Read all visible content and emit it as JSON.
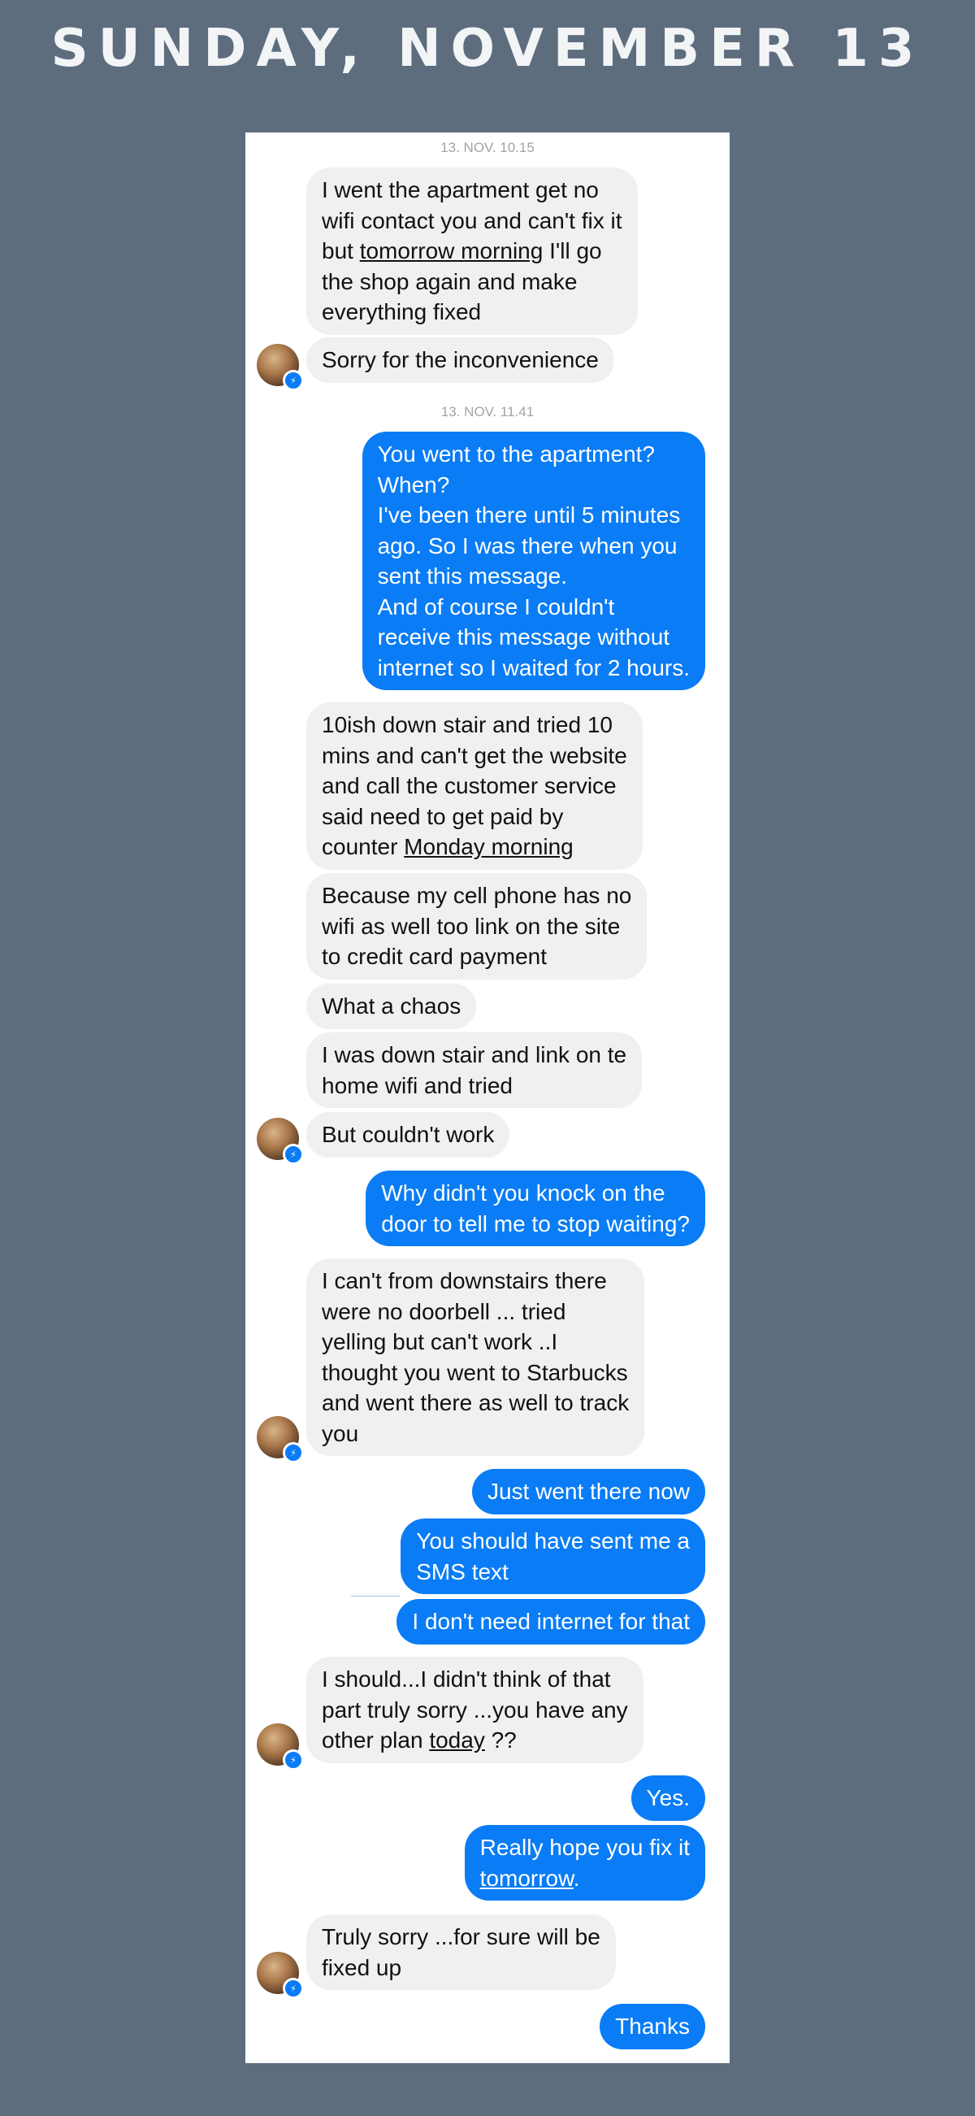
{
  "header": {
    "title": "SUNDAY, NOVEMBER 13"
  },
  "timestamps": [
    "13. NOV. 10.15",
    "13. NOV. 11.41"
  ],
  "messages": [
    {
      "from": "them",
      "parts": [
        [
          "I went the apartment get no\nwifi contact you and can't fix it\nbut ",
          false
        ],
        [
          "tomorrow morning",
          true
        ],
        [
          " I'll go\nthe shop again and make\neverything fixed",
          false
        ]
      ]
    },
    {
      "from": "them",
      "parts": [
        [
          "Sorry for the inconvenience",
          false
        ]
      ]
    },
    {
      "from": "me",
      "parts": [
        [
          "You went to the apartment?\nWhen?\nI've been there until 5 minutes\nago. So I was there when you\nsent this message.\nAnd of course I couldn't\nreceive this message without\ninternet so I waited for 2 hours.",
          false
        ]
      ]
    },
    {
      "from": "them",
      "parts": [
        [
          "10ish down stair and tried 10\nmins and can't get the website\nand call the customer service\nsaid need to get paid by\ncounter ",
          false
        ],
        [
          "Monday morning",
          true
        ]
      ]
    },
    {
      "from": "them",
      "parts": [
        [
          "Because my cell phone has no\nwifi as well too link on the site\nto credit card payment",
          false
        ]
      ]
    },
    {
      "from": "them",
      "parts": [
        [
          "What a chaos",
          false
        ]
      ]
    },
    {
      "from": "them",
      "parts": [
        [
          "I was down stair and link on te\nhome wifi and tried",
          false
        ]
      ]
    },
    {
      "from": "them",
      "parts": [
        [
          "But couldn't work",
          false
        ]
      ]
    },
    {
      "from": "me",
      "parts": [
        [
          "Why didn't you knock on the\ndoor to tell me to stop waiting?",
          false
        ]
      ]
    },
    {
      "from": "them",
      "parts": [
        [
          "I can't from downstairs there\nwere no doorbell ... tried\nyelling but can't work ..I\nthought you went to Starbucks\nand went there as well to track\nyou",
          false
        ]
      ]
    },
    {
      "from": "me",
      "parts": [
        [
          "Just went there now",
          false
        ]
      ]
    },
    {
      "from": "me",
      "parts": [
        [
          "You should have sent me a\nSMS text",
          false
        ]
      ]
    },
    {
      "from": "me",
      "parts": [
        [
          "I don't need internet for that",
          false
        ]
      ]
    },
    {
      "from": "them",
      "parts": [
        [
          "I should...I didn't think of that\npart truly sorry ...you have any\nother plan ",
          false
        ],
        [
          "today",
          true
        ],
        [
          " ??",
          false
        ]
      ]
    },
    {
      "from": "me",
      "parts": [
        [
          "Yes.",
          false
        ]
      ]
    },
    {
      "from": "me",
      "parts": [
        [
          "Really hope you fix it\n",
          false
        ],
        [
          "tomorrow",
          true
        ],
        [
          ".",
          false
        ]
      ]
    },
    {
      "from": "them",
      "parts": [
        [
          "Truly sorry ...for sure will be\nfixed up",
          false
        ]
      ]
    },
    {
      "from": "me",
      "parts": [
        [
          "Thanks",
          false
        ]
      ]
    }
  ],
  "colors": {
    "background": "#5d6d7e",
    "incoming_bubble": "#f0eff1",
    "outgoing_bubble": "#0a7cf5"
  },
  "icons": {
    "avatar": "contact-avatar",
    "badge": "messenger-icon"
  }
}
